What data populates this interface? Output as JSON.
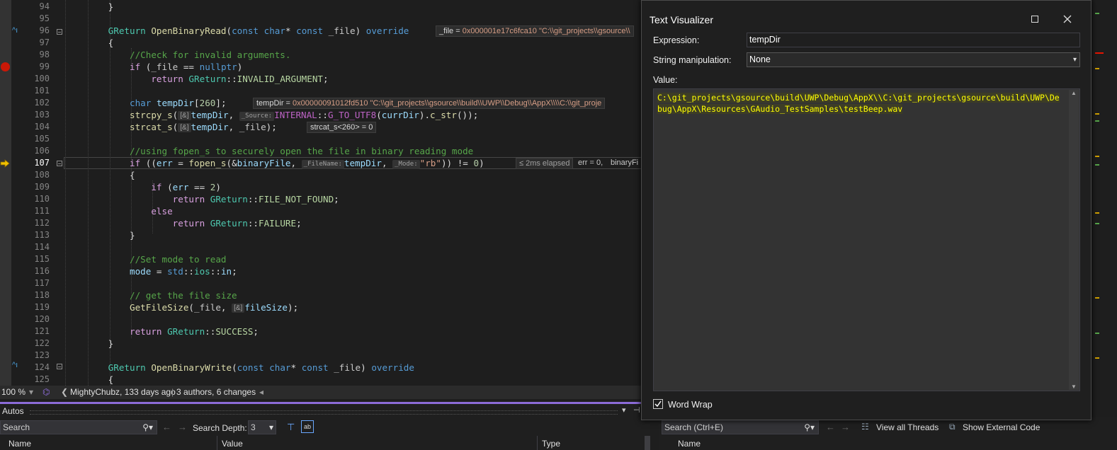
{
  "editor": {
    "lines": [
      {
        "n": "94",
        "html": "        }"
      },
      {
        "n": "95",
        "html": ""
      },
      {
        "n": "96",
        "html": "        <span class='c-ty'>GReturn</span> <span class='c-fn'>OpenBinaryRead</span>(<span class='c-kw'>const</span> <span class='c-kw'>char</span>* <span class='c-kw'>const</span> <span class='c-pt'>_file</span>) <span class='c-kw'>override</span>"
      },
      {
        "n": "97",
        "html": "        {"
      },
      {
        "n": "98",
        "html": "            <span class='c-cm'>//Check for invalid arguments.</span>"
      },
      {
        "n": "99",
        "html": "            <span class='c-ctl'>if</span> (<span class='c-pt'>_file</span> == <span class='c-kw'>nullptr</span>)"
      },
      {
        "n": "100",
        "html": "                <span class='c-ctl'>return</span> <span class='c-ty'>GReturn</span>::<span class='c-enum'>INVALID_ARGUMENT</span>;"
      },
      {
        "n": "101",
        "html": ""
      },
      {
        "n": "102",
        "html": "            <span class='c-kw'>char</span> <span class='c-var'>tempDir</span>[<span class='c-num'>260</span>];"
      },
      {
        "n": "103",
        "html": "            <span class='c-fn'>strcpy_s</span>(<span class='hint'>[&amp;]</span><span class='c-var'>tempDir</span>, <span class='hint code-h'>_Source:</span><span class='c-mac'>INTERNAL</span>::<span class='c-mac'>G_TO_UTF8</span>(<span class='c-var'>currDir</span>).<span class='c-fn'>c_str</span>());"
      },
      {
        "n": "104",
        "html": "            <span class='c-fn'>strcat_s</span>(<span class='hint'>[&amp;]</span><span class='c-var'>tempDir</span>, <span class='c-pt'>_file</span>);"
      },
      {
        "n": "105",
        "html": ""
      },
      {
        "n": "106",
        "html": "            <span class='c-cm'>//using fopen_s to securely open the file in binary reading mode</span>"
      },
      {
        "n": "107",
        "html": "            <span class='c-ctl'>if</span> ((<span class='c-var'>err</span> = <span class='c-fn'>fopen_s</span>(&amp;<span class='c-var'>binaryFile</span>, <span class='hint code-h'>_FileName:</span><span class='c-var'>tempDir</span>, <span class='hint code-h'>_Mode:</span><span class='c-str'>\"rb\"</span>)) != <span class='c-num'>0</span>)"
      },
      {
        "n": "108",
        "html": "            {"
      },
      {
        "n": "109",
        "html": "                <span class='c-ctl'>if</span> (<span class='c-var'>err</span> == <span class='c-num'>2</span>)"
      },
      {
        "n": "110",
        "html": "                    <span class='c-ctl'>return</span> <span class='c-ty'>GReturn</span>::<span class='c-enum'>FILE_NOT_FOUND</span>;"
      },
      {
        "n": "111",
        "html": "                <span class='c-ctl'>else</span>"
      },
      {
        "n": "112",
        "html": "                    <span class='c-ctl'>return</span> <span class='c-ty'>GReturn</span>::<span class='c-enum'>FAILURE</span>;"
      },
      {
        "n": "113",
        "html": "            }"
      },
      {
        "n": "114",
        "html": ""
      },
      {
        "n": "115",
        "html": "            <span class='c-cm'>//Set mode to read</span>"
      },
      {
        "n": "116",
        "html": "            <span class='c-var'>mode</span> = <span class='c-kw'>std</span>::<span class='c-ty'>ios</span>::<span class='c-var'>in</span>;"
      },
      {
        "n": "117",
        "html": ""
      },
      {
        "n": "118",
        "html": "            <span class='c-cm'>// get the file size</span>"
      },
      {
        "n": "119",
        "html": "            <span class='c-fn'>GetFileSize</span>(<span class='c-pt'>_file</span>, <span class='hint'>[&amp;]</span><span class='c-var'>fileSize</span>);"
      },
      {
        "n": "120",
        "html": ""
      },
      {
        "n": "121",
        "html": "            <span class='c-ctl'>return</span> <span class='c-ty'>GReturn</span>::<span class='c-enum'>SUCCESS</span>;"
      },
      {
        "n": "122",
        "html": "        }"
      },
      {
        "n": "123",
        "html": ""
      },
      {
        "n": "124",
        "html": "        <span class='c-ty'>GReturn</span> <span class='c-fn'>OpenBinaryWrite</span>(<span class='c-kw'>const</span> <span class='c-kw'>char</span>* <span class='c-kw'>const</span> <span class='c-pt'>_file</span>) <span class='c-kw'>override</span>"
      },
      {
        "n": "125",
        "html": "        {"
      }
    ],
    "datatips": {
      "file": {
        "name": "_file = ",
        "value": "0x000001e17c6fca10 \"C:\\\\git_projects\\\\gsource\\\\"
      },
      "tempdir": {
        "name": "tempDir = ",
        "value": "0x00000091012fd510 \"C:\\\\git_projects\\\\gsource\\\\build\\\\UWP\\\\Debug\\\\AppX\\\\\\\\C:\\\\git_proje"
      },
      "strcat": "strcat_s<260> = 0",
      "elapsed": "≤ 2ms elapsed",
      "err": "err = 0,",
      "binary": "binaryFi"
    }
  },
  "status": {
    "zoom": "100 %",
    "author": "MightyChubz, 133 days ago",
    "sep": "|",
    "changes": "3 authors, 6 changes"
  },
  "autos": {
    "title": "Autos",
    "search_placeholder": "Search",
    "depth_label": "Search Depth:",
    "depth_value": "3",
    "col_name": "Name",
    "col_value": "Value",
    "col_type": "Type"
  },
  "threads": {
    "search_placeholder": "Search (Ctrl+E)",
    "view_all": "View all Threads",
    "show_external": "Show External Code",
    "col_name": "Name"
  },
  "dialog": {
    "title": "Text Visualizer",
    "expression_label": "Expression:",
    "expression_value": "tempDir",
    "manip_label": "String manipulation:",
    "manip_value": "None",
    "value_label": "Value:",
    "value_text": "C:\\git_projects\\gsource\\build\\UWP\\Debug\\AppX\\\\C:\\git_projects\\gsource\\build\\UWP\\Debug\\AppX\\Resources\\GAudio_TestSamples\\testBeep.wav",
    "word_wrap_label": "Word Wrap",
    "word_wrap_checked": true
  },
  "colors": {
    "breakpoint": "#e51400",
    "accent": "#8c6cd8",
    "arrow": "#f0c000",
    "value_text": "#ffff00"
  }
}
